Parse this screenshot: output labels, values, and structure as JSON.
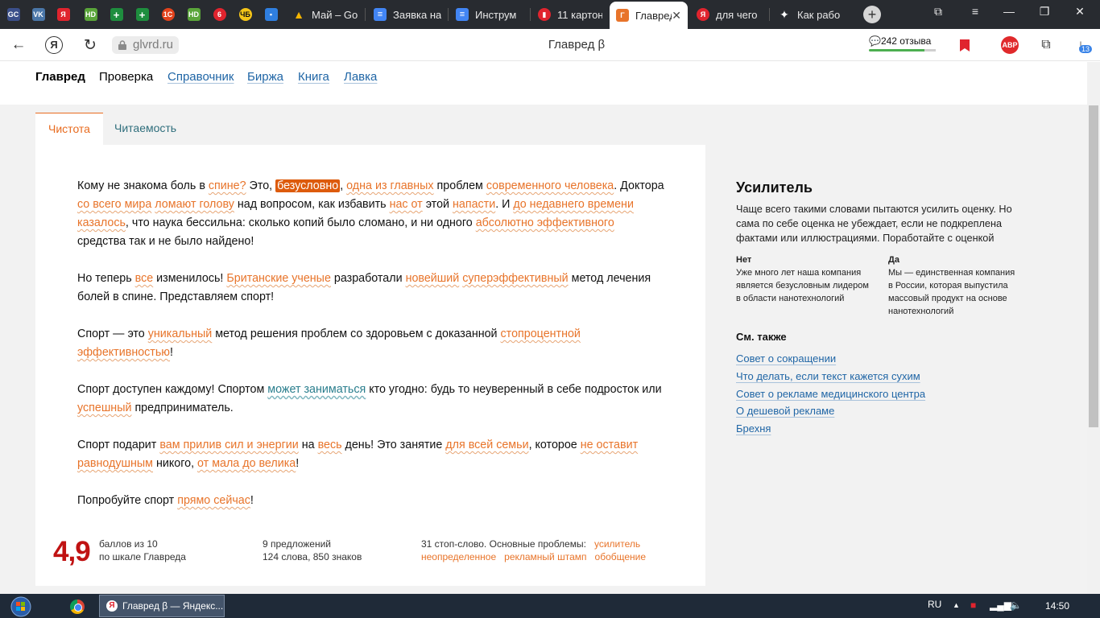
{
  "browser": {
    "tabs": [
      {
        "label": "",
        "icon": "gc-icon",
        "color": "#3b4f8a",
        "glyph": "GC"
      },
      {
        "label": "",
        "icon": "vk-icon",
        "color": "#4a76a8",
        "glyph": "VK"
      },
      {
        "label": "",
        "icon": "yandex-icon",
        "color": "#e0242e",
        "glyph": "Я"
      },
      {
        "label": "",
        "icon": "hd-icon",
        "color": "#5aa53a",
        "glyph": "HD"
      },
      {
        "label": "",
        "icon": "sheets-icon",
        "color": "#1e8e3e",
        "glyph": "+"
      },
      {
        "label": "",
        "icon": "sheets-icon",
        "color": "#1e8e3e",
        "glyph": "+"
      },
      {
        "label": "",
        "icon": "record-icon",
        "color": "#e3431c",
        "glyph": "1С"
      },
      {
        "label": "",
        "icon": "hd-icon",
        "color": "#5aa53a",
        "glyph": "HD"
      },
      {
        "label": "",
        "icon": "six-icon",
        "color": "#e0242e",
        "glyph": "6"
      },
      {
        "label": "",
        "icon": "chb-icon",
        "color": "#f5c518",
        "glyph": "ЧБ"
      },
      {
        "label": "",
        "icon": "chat-icon",
        "color": "#2f7fe0",
        "glyph": "▪"
      },
      {
        "label": "Май – Go",
        "icon": "drive-icon",
        "color": "#f4b400",
        "glyph": "▲"
      },
      {
        "label": "Заявка на",
        "icon": "docs-icon",
        "color": "#4285f4",
        "glyph": "≡"
      },
      {
        "label": "Инструм",
        "icon": "docs-icon",
        "color": "#4285f4",
        "glyph": "≡"
      },
      {
        "label": "11 картон",
        "icon": "bookmark-icon",
        "color": "#e0242e",
        "glyph": "▮"
      },
      {
        "label": "Главред",
        "icon": "glvrd-icon",
        "color": "#e8742a",
        "glyph": "Γ"
      },
      {
        "label": "для чего",
        "icon": "yandex-icon",
        "color": "#e0242e",
        "glyph": "Я"
      },
      {
        "label": "Как рабо",
        "icon": "sparkle-icon",
        "color": "#282b30",
        "glyph": "✦"
      }
    ],
    "url": "glvrd.ru",
    "page_title": "Главред β",
    "reviews": "242 отзыва",
    "abp": "ABP",
    "downloads_badge": "13"
  },
  "site": {
    "nav": {
      "brand": "Главред",
      "current": "Проверка",
      "links": [
        "Справочник",
        "Биржа",
        "Книга",
        "Лавка"
      ]
    },
    "tabs": {
      "clean": "Чистота",
      "readability": "Читаемость"
    }
  },
  "stats": {
    "score": "4,9",
    "score_line1": "баллов из 10",
    "score_line2": "по шкале Главреда",
    "sentences": "9 предложений",
    "words": "124 слова, 850 знаков",
    "stopwords": "31 стоп-слово. Основные проблемы:",
    "problems": [
      "усилитель",
      "неопределенное",
      "рекламный штамп",
      "обобщение"
    ]
  },
  "sidebar": {
    "title": "Усилитель",
    "description": "Чаще всего такими словами пытаются усилить оценку. Но сама по себе оценка не убеждает, если не подкреплена фактами или иллюстрациями. Поработайте с оценкой",
    "no_label": "Нет",
    "no_text": "Уже много лет наша компания является безусловным лидером в области нанотехнологий",
    "yes_label": "Да",
    "yes_text": "Мы — единственная компания в России, которая выпустила массовый продукт на основе нанотехнологий",
    "see_also": "См. также",
    "links": [
      "Совет о сокращении",
      "Что делать, если текст кажется сухим",
      "Совет о рекламе медицинского центра",
      "О дешевой рекламе",
      "Брехня"
    ]
  },
  "taskbar": {
    "app": "Главред β — Яндекс...",
    "lang": "RU",
    "time": "14:50"
  },
  "accent": "#e8742a"
}
